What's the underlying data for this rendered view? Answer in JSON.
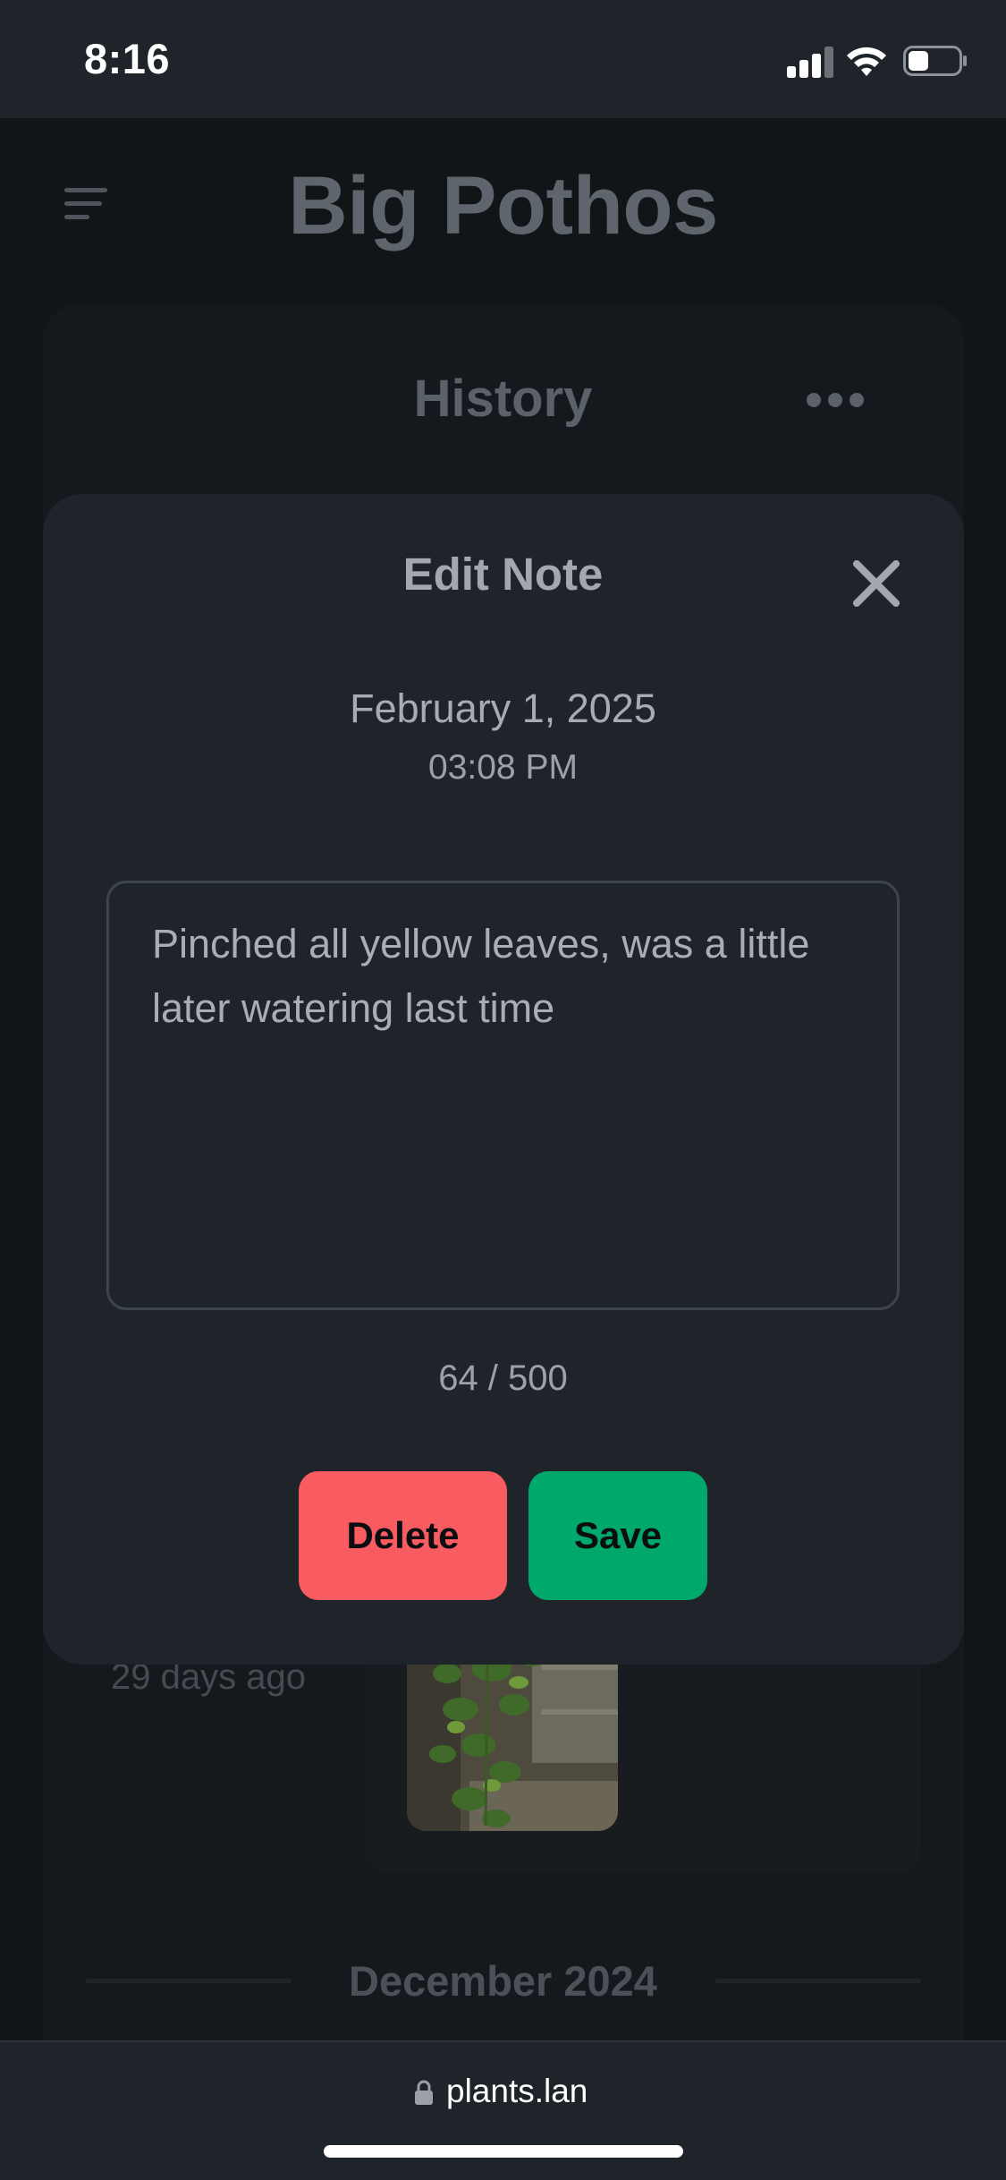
{
  "status_bar": {
    "time": "8:16"
  },
  "header": {
    "title": "Big Pothos",
    "menu_icon": "hamburger-menu-icon"
  },
  "history": {
    "title": "History",
    "more_icon": "more-options-icon",
    "entry": {
      "ago": "29 days ago",
      "photo": "pothos-plant-photo"
    },
    "month_label": "December 2024"
  },
  "modal": {
    "title": "Edit Note",
    "close_icon": "close-icon",
    "date": "February 1, 2025",
    "time": "03:08 PM",
    "note_text": "Pinched all yellow leaves, was a little later watering last time",
    "char_count": "64 / 500",
    "delete_label": "Delete",
    "save_label": "Save",
    "colors": {
      "delete": "#f85b60",
      "save": "#00a86b",
      "modal_bg": "#1f242b"
    }
  },
  "browser": {
    "url": "plants.lan",
    "lock_icon": "lock-icon"
  }
}
